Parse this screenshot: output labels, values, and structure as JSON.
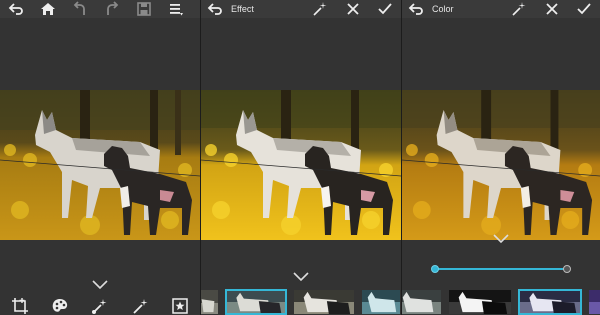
{
  "panels": [
    {
      "id": "main",
      "toolbar": [
        "undo-arrow-icon",
        "home-icon",
        "undo-icon",
        "redo-icon",
        "save-icon",
        "menu-icon"
      ],
      "bottom_tools": [
        "crop-icon",
        "palette-icon",
        "magic-wand-brush-icon",
        "magic-wand-icon",
        "sticker-star-icon"
      ]
    },
    {
      "id": "effect",
      "title": "Effect",
      "toolbar": [
        "back-icon",
        "magic-wand-icon",
        "close-icon",
        "check-icon"
      ],
      "thumbnails": 4,
      "selected_thumbnail": 1
    },
    {
      "id": "color",
      "title": "Color",
      "toolbar": [
        "back-icon",
        "magic-wand-icon",
        "close-icon",
        "check-icon"
      ],
      "slider_value": 1.0,
      "thumbnails": 4,
      "selected_thumbnail": 2
    }
  ],
  "colors": {
    "accent": "#35b7d6",
    "panel_bg": "#333333",
    "toolbar_bg": "#3a3a3a"
  }
}
